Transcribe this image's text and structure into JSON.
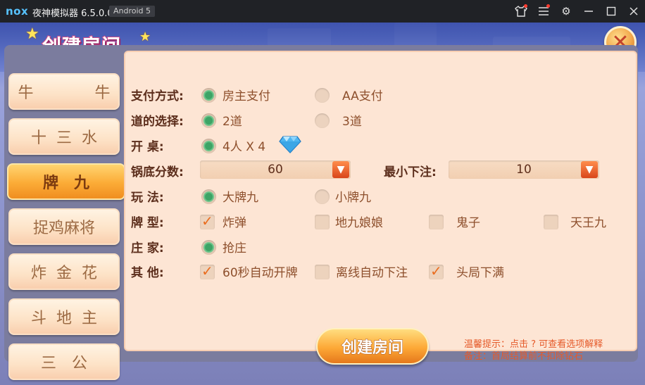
{
  "titlebar": {
    "app_name": "夜神模拟器 6.5.0.0",
    "android_badge": "Android 5",
    "logo_text": "nox",
    "icons": [
      "shirt-icon",
      "menu-icon",
      "gear-icon",
      "minimize-icon",
      "maximize-icon",
      "close-icon"
    ]
  },
  "dialog": {
    "title": "创建房间",
    "close_icon": "close-x-icon"
  },
  "menu": {
    "items": [
      {
        "label": "牛  牛",
        "active": false
      },
      {
        "label": "十三水",
        "active": false
      },
      {
        "label": "牌九",
        "active": true
      },
      {
        "label": "捉鸡麻将",
        "active": false
      },
      {
        "label": "炸金花",
        "active": false
      },
      {
        "label": "斗地主",
        "active": false
      },
      {
        "label": "三公",
        "active": false
      }
    ]
  },
  "form": {
    "payment": {
      "label": "支付方式:",
      "opt1": "房主支付",
      "opt2": "AA支付",
      "selected": 1
    },
    "lane": {
      "label": "道的选择:",
      "opt1": "2道",
      "opt2": "3道",
      "selected": 1
    },
    "table": {
      "label": "开    桌:",
      "value": "4人 X 4",
      "icon": "diamond-icon"
    },
    "pot": {
      "label": "锅底分数:",
      "value": "60"
    },
    "min_bet": {
      "label": "最小下注:",
      "value": "10"
    },
    "play": {
      "label": "玩    法:",
      "opt1": "大牌九",
      "opt2": "小牌九",
      "selected": 1
    },
    "card_type": {
      "label": "牌    型:",
      "opt1": "炸弹",
      "opt2": "地九娘娘",
      "opt3": "鬼子",
      "opt4": "天王九",
      "checked": [
        true,
        false,
        false,
        false
      ]
    },
    "dealer": {
      "label": "庄    家:",
      "opt1": "抢庄",
      "selected": 1
    },
    "other": {
      "label": "其    他:",
      "opt1": "60秒自动开牌",
      "opt2": "离线自动下注",
      "opt3": "头局下满",
      "checked": [
        true,
        false,
        true
      ]
    }
  },
  "create_button": "创建房间",
  "tips": {
    "line1": "温馨提示：点击 ? 可查看选项解释",
    "line2": "备注：首局结算前不扣除钻石"
  },
  "colors": {
    "accent": "#f08e20",
    "panel": "#fde5d4",
    "radio_on": "#3da466",
    "tip_text": "#e55a2a"
  }
}
